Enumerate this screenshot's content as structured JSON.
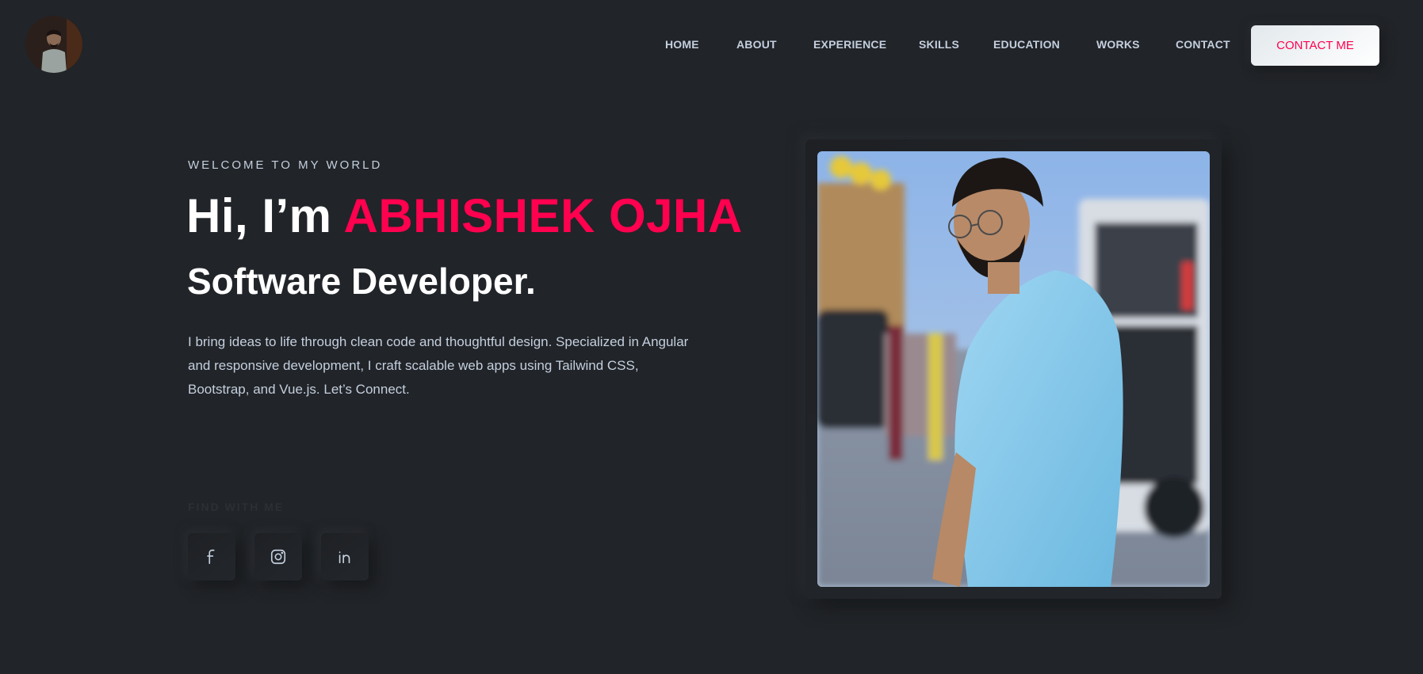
{
  "header": {
    "avatar_icon": "profile-avatar",
    "nav": [
      {
        "label": "HOME"
      },
      {
        "label": "ABOUT"
      },
      {
        "label": "EXPERIENCE"
      },
      {
        "label": "SKILLS"
      },
      {
        "label": "EDUCATION"
      },
      {
        "label": "WORKS"
      },
      {
        "label": "CONTACT"
      }
    ],
    "cta_label": "CONTACT ME"
  },
  "hero": {
    "kicker": "WELCOME TO MY WORLD",
    "greeting": "Hi, I’m ",
    "name": "ABHISHEK OJHA",
    "role": "Software Developer.",
    "description": "I bring ideas to life through clean code and thoughtful design. Specialized in Angular and responsive development, I craft scalable web apps using Tailwind CSS, Bootstrap, and Vue.js. Let’s Connect.",
    "find_label": "FIND WITH ME",
    "social": [
      {
        "icon": "facebook-icon"
      },
      {
        "icon": "instagram-icon"
      },
      {
        "icon": "linkedin-icon"
      }
    ]
  },
  "theme": {
    "background": "#212428",
    "accent": "#ff014f",
    "text": "#c4cfde",
    "heading": "#ffffff"
  }
}
